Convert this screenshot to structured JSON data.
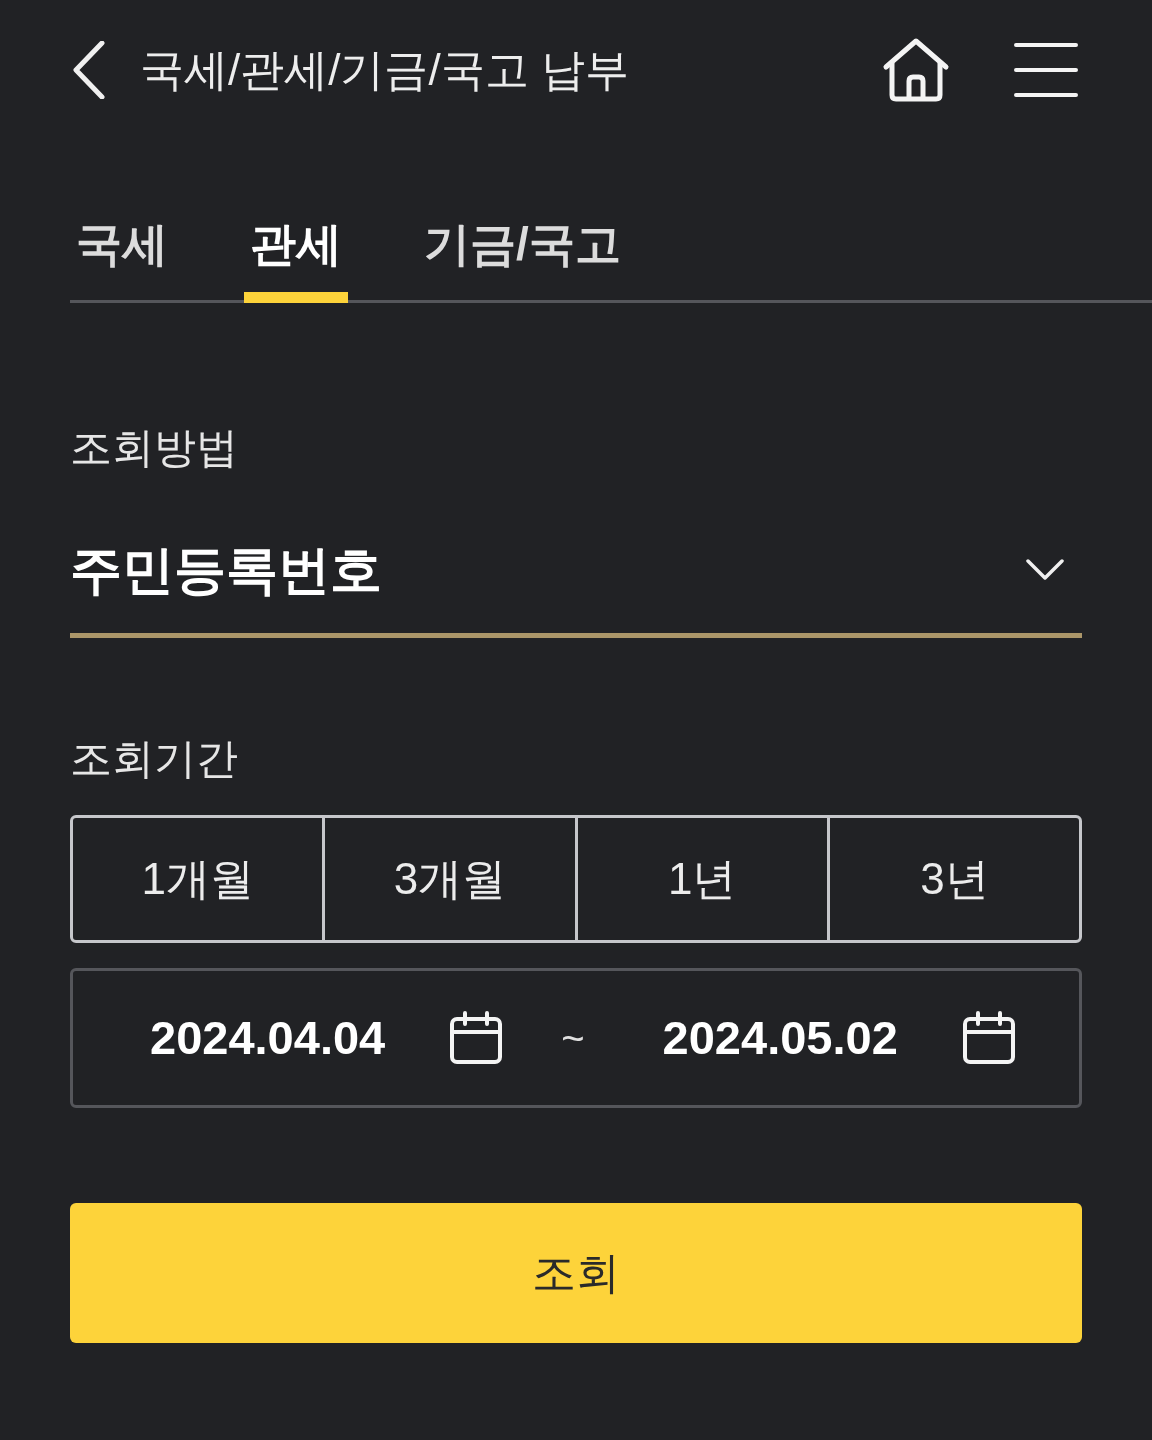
{
  "header": {
    "title": "국세/관세/기금/국고 납부"
  },
  "tabs": [
    {
      "label": "국세",
      "selected": false
    },
    {
      "label": "관세",
      "selected": true
    },
    {
      "label": "기금/국고",
      "selected": false
    }
  ],
  "inquiry_method": {
    "label": "조회방법",
    "value": "주민등록번호"
  },
  "inquiry_period": {
    "label": "조회기간",
    "periods": [
      "1개월",
      "3개월",
      "1년",
      "3년"
    ],
    "start_date": "2024.04.04",
    "separator": "~",
    "end_date": "2024.05.02"
  },
  "submit_button": {
    "label": "조회"
  }
}
